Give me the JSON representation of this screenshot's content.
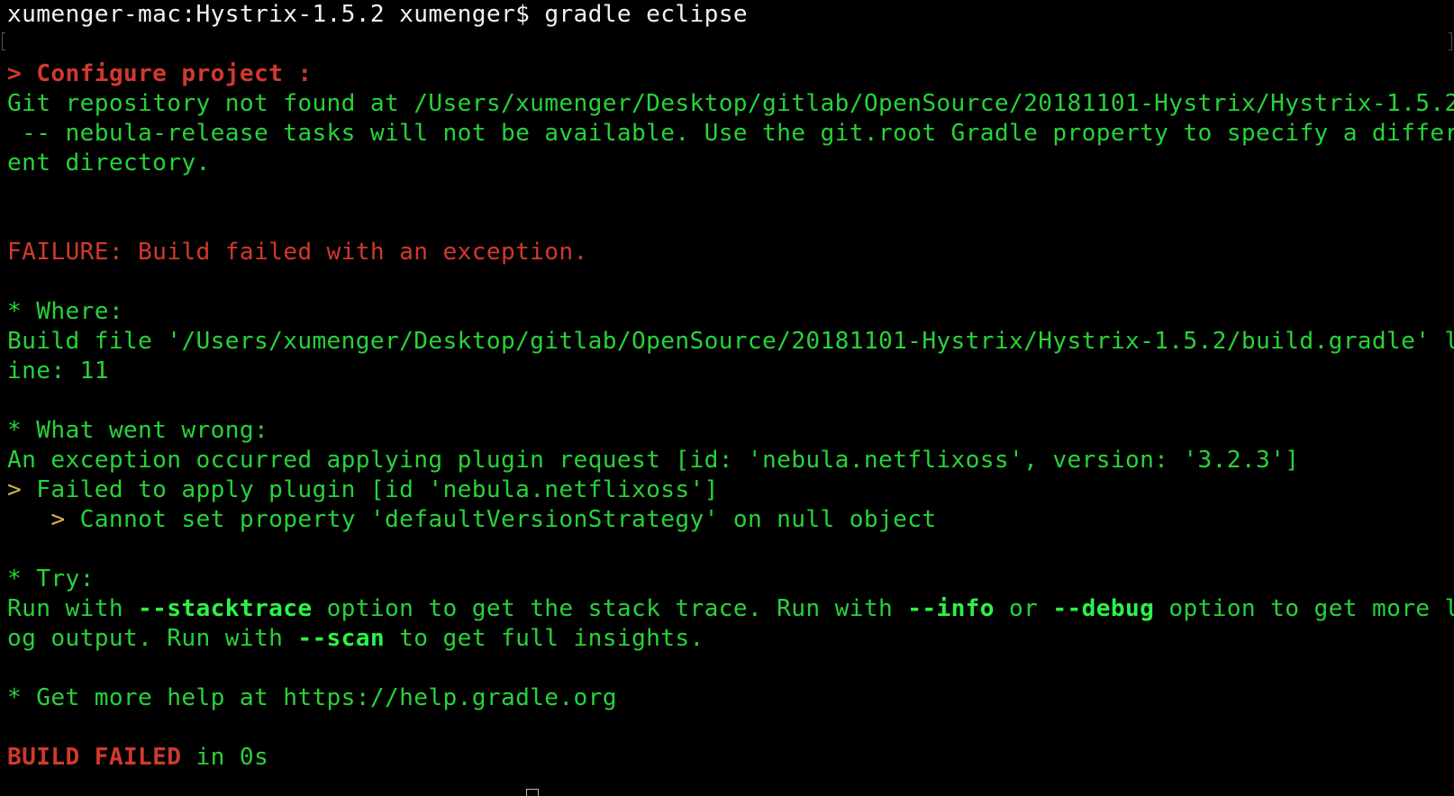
{
  "terminal": {
    "prompt": "xumenger-mac:Hystrix-1.5.2 xumenger$",
    "command": "gradle eclipse",
    "configure_line": "> Configure project :",
    "git_warning_lines": [
      "Git repository not found at /Users/xumenger/Desktop/gitlab/OpenSource/20181101-Hystrix/Hystrix-1.5.2",
      " -- nebula-release tasks will not be available. Use the git.root Gradle property to specify a differ",
      "ent directory."
    ],
    "failure_line": "FAILURE: Build failed with an exception.",
    "where_header": "* Where:",
    "where_lines": [
      "Build file '/Users/xumenger/Desktop/gitlab/OpenSource/20181101-Hystrix/Hystrix-1.5.2/build.gradle' l",
      "ine: 11"
    ],
    "wrong_header": "* What went wrong:",
    "wrong_line": "An exception occurred applying plugin request [id: 'nebula.netflixoss', version: '3.2.3']",
    "failed_apply_arrow": ">",
    "failed_apply_text": " Failed to apply plugin [id 'nebula.netflixoss']",
    "cannot_set_indent": "   ",
    "cannot_set_arrow": ">",
    "cannot_set_text": " Cannot set property 'defaultVersionStrategy' on null object",
    "try_header": "* Try:",
    "try_line1": {
      "p1": "Run with ",
      "opt1": "--stacktrace",
      "p2": " option to get the stack trace. Run with ",
      "opt2": "--info",
      "p3": " or ",
      "opt3": "--debug",
      "p4": " option to get more l"
    },
    "try_line2": {
      "p1": "og output. Run with ",
      "opt1": "--scan",
      "p2": " to get full insights."
    },
    "help_line": "* Get more help at https://help.gradle.org",
    "build_failed_label": "BUILD FAILED",
    "build_failed_suffix": " in 0s"
  },
  "colors": {
    "background": "#000000",
    "prompt_text": "#f2f2f2",
    "output_green": "#28d23a",
    "error_red": "#d1392d",
    "arrow_yellow": "#d5b34a",
    "option_bright_green": "#2cf246"
  }
}
